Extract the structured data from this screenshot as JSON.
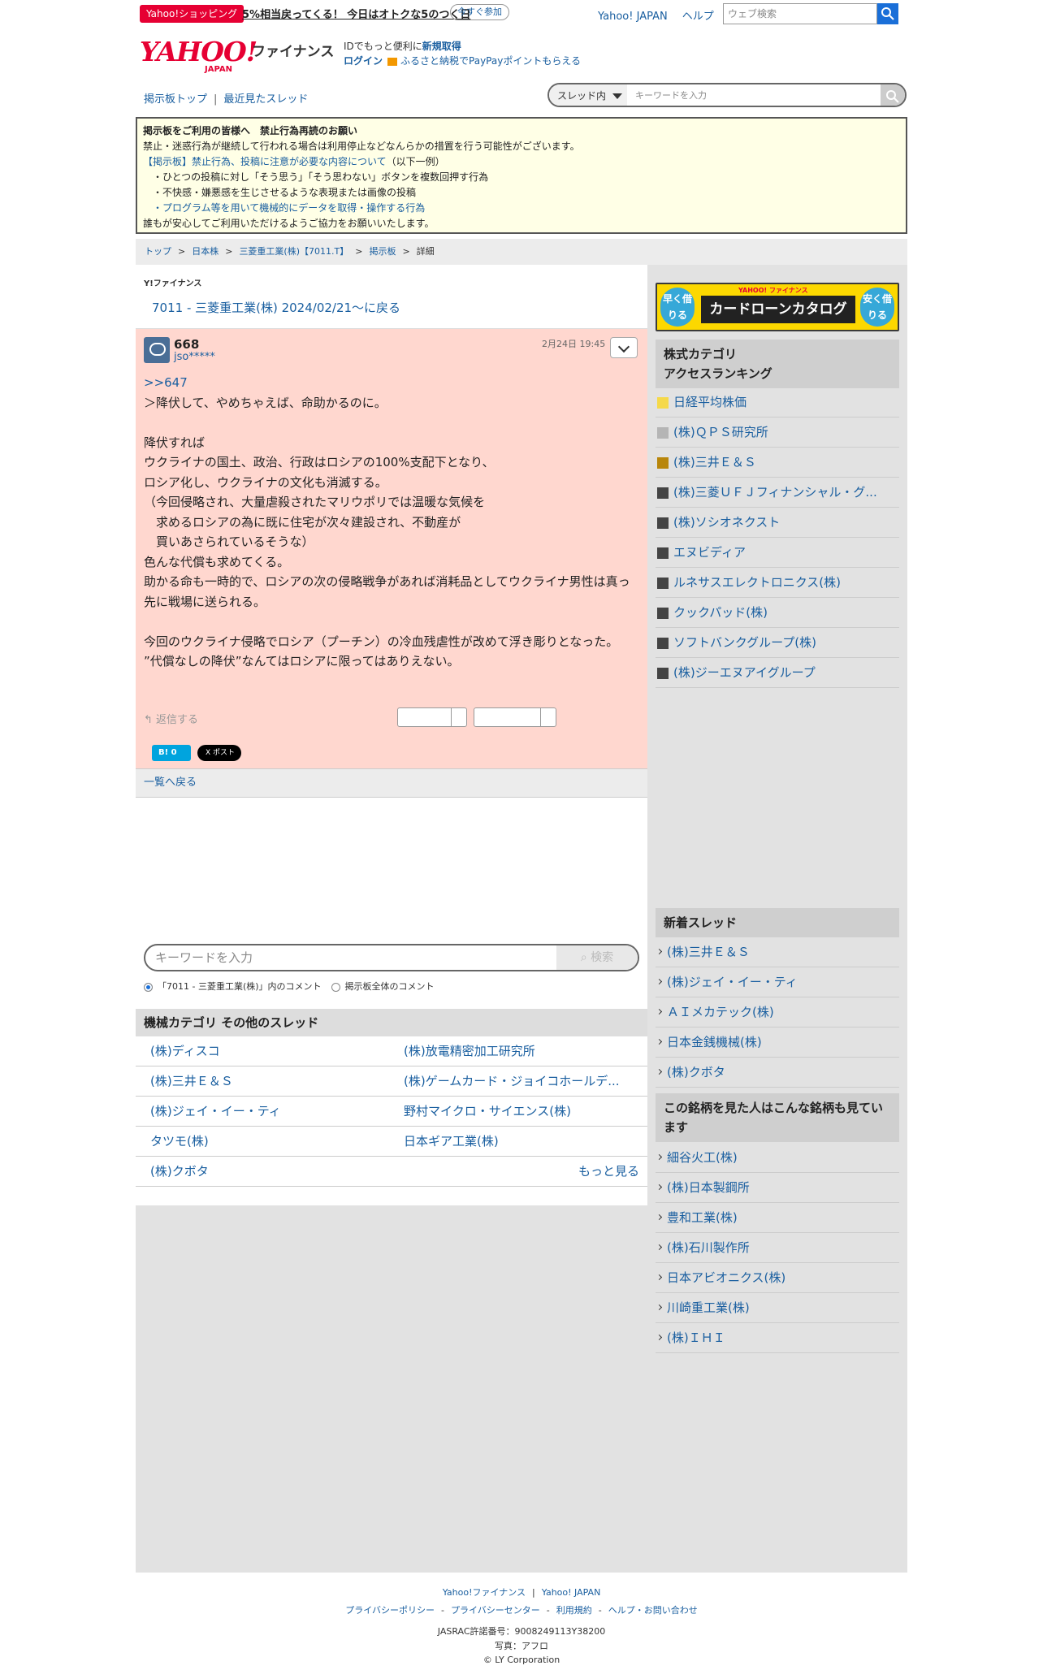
{
  "topbar": {
    "promo_badge": "Yahoo!ショッピング",
    "promo_text": "5%相当戻ってくる！ 今日はオトクな5のつく日",
    "promo_join": "今すぐ参加",
    "yahoo_japan": "Yahoo! JAPAN",
    "help": "ヘルプ",
    "search_placeholder": "ウェブ検索"
  },
  "header": {
    "logo": "YAHOO!",
    "logo_sub": "JAPAN",
    "finance": "ファイナンス",
    "id_text": "IDでもっと便利に",
    "id_register": "新規取得",
    "login": "ログイン",
    "furusato": "ふるさと納税でPayPayポイントもらえる"
  },
  "nav": {
    "board_top": "掲示板トップ",
    "recent_threads": "最近見たスレッド",
    "scope": "スレッド内",
    "keyword_placeholder": "キーワードを入力"
  },
  "notice": {
    "title": "掲示板をご利用の皆様へ　禁止行為再読のお願い",
    "line1": "禁止・迷惑行為が継続して行われる場合は利用停止などなんらかの措置を行う可能性がございます。",
    "link1": "【掲示板】禁止行為、投稿に注意が必要な内容について",
    "link1_suffix": "（以下一例）",
    "item1": "・ひとつの投稿に対し「そう思う」「そう思わない」ボタンを複数回押す行為",
    "item2": "・不快感・嫌悪感を生じさせるような表現または画像の投稿",
    "item3": "・プログラム等を用いて機械的にデータを取得・操作する行為",
    "closing": "誰もが安心してご利用いただけるようご協力をお願いいたします。"
  },
  "breadcrumb": {
    "top": "トップ",
    "jp_stocks": "日本株",
    "company": "三菱重工業(株)【7011.T】",
    "board": "掲示板",
    "detail": "詳細",
    "sep": ">"
  },
  "main": {
    "mini_logo": "Y!ファイナンス",
    "back_link": "7011 - 三菱重工業(株) 2024/02/21〜に戻る",
    "post": {
      "number": "668",
      "user": "jso*****",
      "date": "2月24日 19:45",
      "ref": ">>647",
      "body": "＞降伏して、やめちゃえば、命助かるのに。\n\n降伏すれば\nウクライナの国土、政治、行政はロシアの100%支配下となり、\nロシア化し、ウクライナの文化も消滅する。\n（今回侵略され、大量虐殺されたマリウポリでは温暖な気候を\n　求めるロシアの為に既に住宅が次々建設され、不動産が\n　買いあさられているそうな）\n色んな代償も求めてくる。\n助かる命も一時的で、ロシアの次の侵略戦争があれば消耗品としてウクライナ男性は真っ先に戦場に送られる。\n\n今回のウクライナ侵略でロシア（プーチン）の冷血残虐性が改めて浮き彫りとなった。\n”代償なしの降伏”なんてはロシアに限ってはありえない。",
      "reply": "返信する",
      "hatena": "B! 0",
      "x_post": "X ポスト"
    },
    "list_back": "一覧へ戻る",
    "search": {
      "placeholder": "キーワードを入力",
      "button": "検索",
      "radio1": "「7011 - 三菱重工業(株)」内のコメント",
      "radio2": "掲示板全体のコメント"
    },
    "other_threads": {
      "title": "機械カテゴリ  その他のスレッド",
      "rows": [
        [
          "(株)ディスコ",
          "(株)放電精密加工研究所"
        ],
        [
          "(株)三井Ｅ＆Ｓ",
          "(株)ゲームカード・ジョイコホールデ..."
        ],
        [
          "(株)ジェイ・イー・ティ",
          "野村マイクロ・サイエンス(株)"
        ],
        [
          "タツモ(株)",
          "日本ギア工業(株)"
        ],
        [
          "(株)クボタ",
          ""
        ]
      ],
      "more": "もっと見る"
    }
  },
  "sidebar": {
    "ad": {
      "left": "早く借りる",
      "right": "安く借りる",
      "center": "カードローンカタログ",
      "top": "YAHOO! ファイナンス"
    },
    "ranking_title": "株式カテゴリ\nアクセスランキング",
    "ranking": [
      {
        "label": "日経平均株価",
        "color": "#f5d94a"
      },
      {
        "label": "(株)ＱＰＳ研究所",
        "color": "#b5b5b5"
      },
      {
        "label": "(株)三井Ｅ＆Ｓ",
        "color": "#b8860b"
      },
      {
        "label": "(株)三菱ＵＦＪフィナンシャル・グ...",
        "color": "#444444"
      },
      {
        "label": "(株)ソシオネクスト",
        "color": "#444444"
      },
      {
        "label": "エヌビディア",
        "color": "#444444"
      },
      {
        "label": "ルネサスエレクトロニクス(株)",
        "color": "#444444"
      },
      {
        "label": "クックパッド(株)",
        "color": "#444444"
      },
      {
        "label": "ソフトバンクグループ(株)",
        "color": "#444444"
      },
      {
        "label": "(株)ジーエヌアイグループ",
        "color": "#444444"
      }
    ],
    "new_threads_title": "新着スレッド",
    "new_threads": [
      "(株)三井Ｅ＆Ｓ",
      "(株)ジェイ・イー・ティ",
      "ＡＩメカテック(株)",
      "日本金銭機械(株)",
      "(株)クボタ"
    ],
    "viewed_title": "この銘柄を見た人はこんな銘柄も見ています",
    "viewed": [
      "細谷火工(株)",
      "(株)日本製鋼所",
      "豊和工業(株)",
      "(株)石川製作所",
      "日本アビオニクス(株)",
      "川崎重工業(株)",
      "(株)ＩＨＩ"
    ]
  },
  "footer": {
    "yahoo_finance": "Yahoo!ファイナンス",
    "yahoo_japan": "Yahoo! JAPAN",
    "privacy_policy": "プライバシーポリシー",
    "privacy_center": "プライバシーセンター",
    "terms": "利用規約",
    "help": "ヘルプ・お問い合わせ",
    "jasrac": "JASRAC許諾番号：9008249113Y38200",
    "photo": "写真：アフロ",
    "copyright": "© LY Corporation"
  }
}
